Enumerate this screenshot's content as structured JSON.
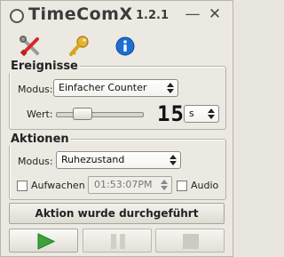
{
  "app": {
    "title": "TimeComX",
    "version": "1.2.1",
    "minimize_label": "—",
    "close_label": "✕"
  },
  "toolbar": {
    "icons": [
      "tools-icon",
      "key-icon",
      "info-icon"
    ]
  },
  "events": {
    "title": "Ereignisse",
    "mode_label": "Modus:",
    "mode_value": "Einfacher Counter",
    "value_label": "Wert:",
    "value_display": "15",
    "unit_value": "s",
    "slider_fraction": 0.15
  },
  "actions": {
    "title": "Aktionen",
    "mode_label": "Modus:",
    "mode_value": "Ruhezustand",
    "wake_label": "Aufwachen",
    "wake_checked": false,
    "time_value": "01:53:07PM",
    "audio_label": "Audio",
    "audio_checked": false
  },
  "status": {
    "text": "Aktion wurde durchgeführt"
  },
  "controls": {
    "play": "play-icon",
    "pause": "pause-icon",
    "stop": "stop-icon"
  },
  "colors": {
    "play_green": "#3aa43a",
    "info_blue": "#1c6fd1",
    "key_gold": "#d9a21c"
  }
}
